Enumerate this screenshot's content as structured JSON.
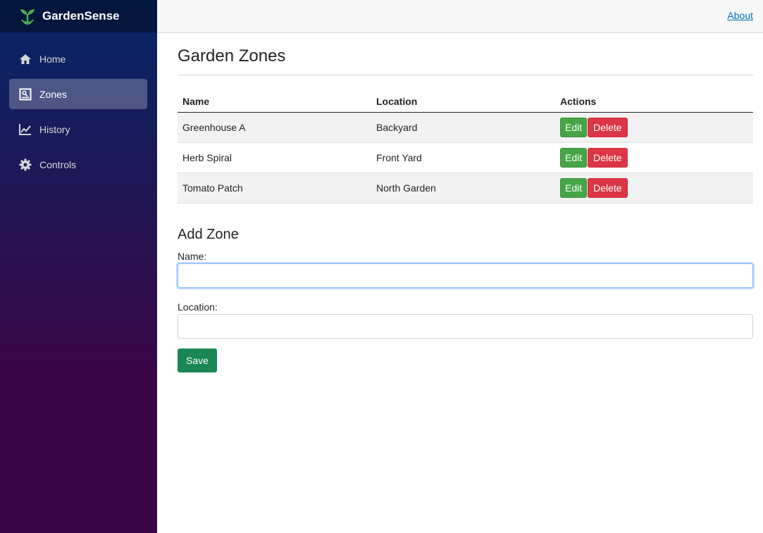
{
  "brand": {
    "name": "GardenSense"
  },
  "sidebar": {
    "items": [
      {
        "label": "Home",
        "icon": "home-icon",
        "active": false
      },
      {
        "label": "Zones",
        "icon": "zones-icon",
        "active": true
      },
      {
        "label": "History",
        "icon": "chart-icon",
        "active": false
      },
      {
        "label": "Controls",
        "icon": "gear-icon",
        "active": false
      }
    ]
  },
  "topbar": {
    "about_label": "About"
  },
  "main": {
    "title": "Garden Zones",
    "table": {
      "headers": [
        "Name",
        "Location",
        "Actions"
      ],
      "rows": [
        {
          "name": "Greenhouse A",
          "location": "Backyard"
        },
        {
          "name": "Herb Spiral",
          "location": "Front Yard"
        },
        {
          "name": "Tomato Patch",
          "location": "North Garden"
        }
      ],
      "edit_label": "Edit",
      "delete_label": "Delete"
    },
    "form": {
      "title": "Add Zone",
      "name_label": "Name:",
      "name_value": "",
      "location_label": "Location:",
      "location_value": "",
      "save_label": "Save"
    }
  },
  "colors": {
    "sidebar_top": "#052767",
    "sidebar_bottom": "#3a0647",
    "edit": "#46a546",
    "delete": "#dc3545",
    "save": "#198754",
    "link": "#0071c1"
  }
}
